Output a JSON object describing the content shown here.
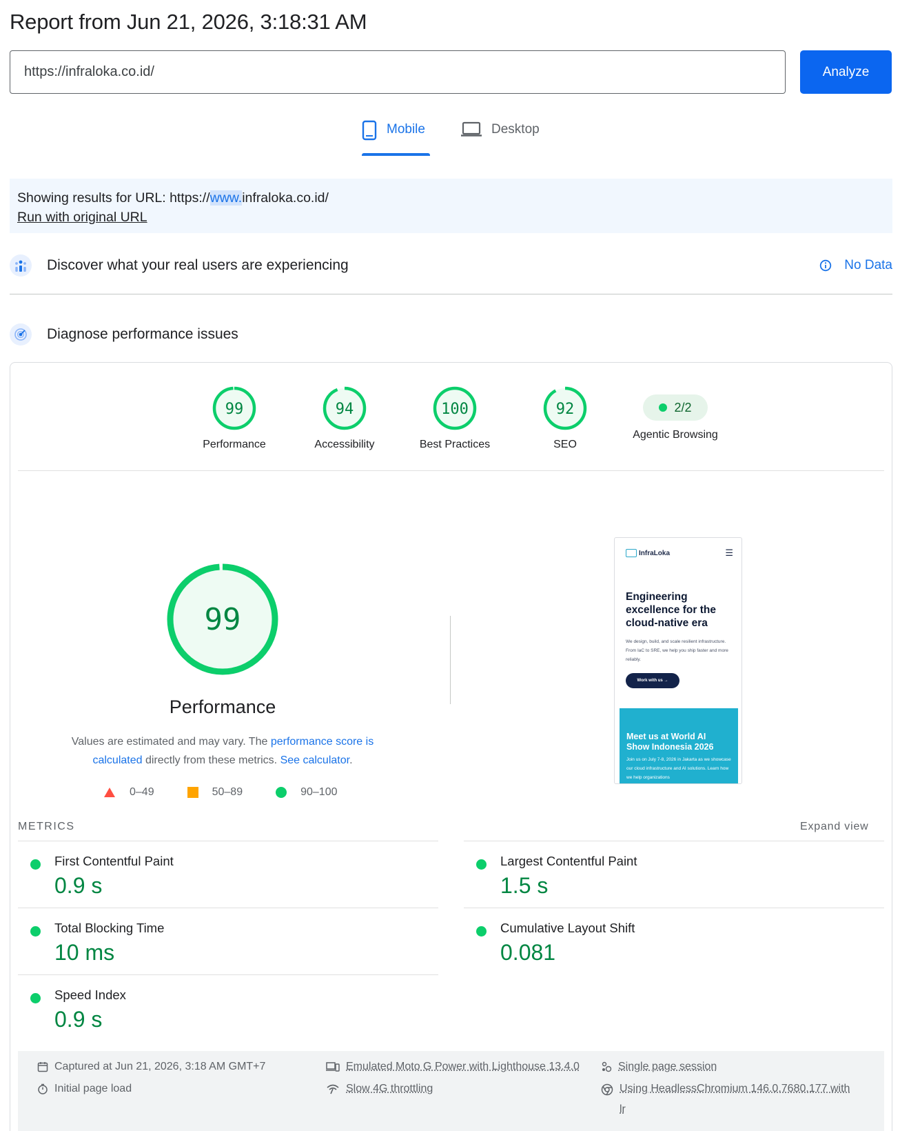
{
  "report": {
    "title": "Report from Jun 21, 2026, 3:18:31 AM"
  },
  "search": {
    "url": "https://infraloka.co.id/",
    "analyze_label": "Analyze"
  },
  "tabs": [
    {
      "label": "Mobile",
      "active": true
    },
    {
      "label": "Desktop",
      "active": false
    }
  ],
  "notice": {
    "prefix": "Showing results for URL: https://",
    "highlight": "www.",
    "suffix": "infraloka.co.id/",
    "link": "Run with original URL"
  },
  "crux": {
    "title": "Discover what your real users are experiencing",
    "status": "No Data"
  },
  "diagnose": {
    "title": "Diagnose performance issues"
  },
  "scores": [
    {
      "label": "Performance",
      "value": 99
    },
    {
      "label": "Accessibility",
      "value": 94
    },
    {
      "label": "Best Practices",
      "value": 100
    },
    {
      "label": "SEO",
      "value": 92
    }
  ],
  "agentic": {
    "label": "Agentic Browsing",
    "value": "2/2"
  },
  "performance": {
    "score": 99,
    "title": "Performance",
    "desc_1": "Values are estimated and may vary. The ",
    "desc_link_1": "performance score is calculated",
    "desc_2": " directly from these metrics. ",
    "desc_link_2": "See calculator",
    "desc_3": "."
  },
  "legend": [
    {
      "range": "0–49",
      "color": "#ff4e42"
    },
    {
      "range": "50–89",
      "color": "#ffa400"
    },
    {
      "range": "90–100",
      "color": "#0cce6b"
    }
  ],
  "preview": {
    "brand": "InfraLoka",
    "hero": "Engineering excellence for the cloud-native era",
    "copy": "We design, build, and scale resilient infrastructure. From IaC to SRE, we help you ship faster and more reliably.",
    "cta": "Work with us →",
    "banner_title": "Meet us at World AI Show Indonesia 2026",
    "banner_copy": "Join us on July 7-8, 2026 in Jakarta as we showcase our cloud infrastructure and AI solutions. Learn how we help organizations"
  },
  "metrics": {
    "heading": "METRICS",
    "expand_label": "Expand view",
    "items": [
      {
        "label": "First Contentful Paint",
        "value": "0.9 s"
      },
      {
        "label": "Largest Contentful Paint",
        "value": "1.5 s"
      },
      {
        "label": "Total Blocking Time",
        "value": "10 ms"
      },
      {
        "label": "Cumulative Layout Shift",
        "value": "0.081"
      },
      {
        "label": "Speed Index",
        "value": "0.9 s"
      }
    ]
  },
  "footer": {
    "captured": "Captured at Jun 21, 2026, 3:18 AM GMT+7",
    "load": "Initial page load",
    "device": "Emulated Moto G Power with Lighthouse 13.4.0",
    "throttling": "Slow 4G throttling",
    "session": "Single page session",
    "browser_1": "Using HeadlessChromium 146.0.7680.177 with",
    "browser_2": "lr"
  },
  "colors": {
    "pass": "#0cce6b",
    "pass_text": "#018642",
    "accent": "#1a73e8",
    "button": "#0b66f0"
  }
}
